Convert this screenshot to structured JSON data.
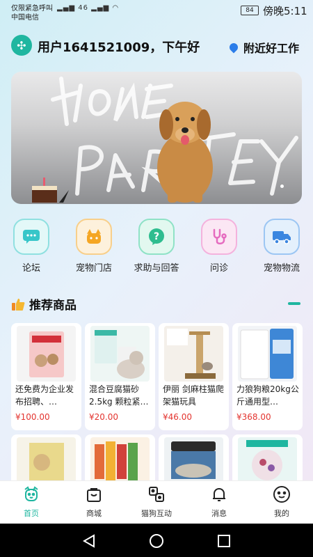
{
  "status_bar": {
    "line1": "仅限紧急呼叫",
    "line2": "中国电信",
    "network": "46",
    "battery": "84",
    "time": "傍晚5:11"
  },
  "header": {
    "greeting": "用户1641521009，下午好",
    "location_label": "附近好工作"
  },
  "categories": [
    {
      "label": "论坛",
      "icon": "chat-icon",
      "color": "#37c6c9"
    },
    {
      "label": "宠物门店",
      "icon": "cat-shop-icon",
      "color": "#f5a623"
    },
    {
      "label": "求助与回答",
      "icon": "question-icon",
      "color": "#2ebd8f"
    },
    {
      "label": "问诊",
      "icon": "stethoscope-icon",
      "color": "#e56bbf"
    },
    {
      "label": "宠物物流",
      "icon": "truck-icon",
      "color": "#3b86e0"
    }
  ],
  "section": {
    "title": "推荐商品"
  },
  "products": [
    {
      "name": "还免费为企业发布招聘、…",
      "price": "¥100.00"
    },
    {
      "name": "混合豆腐猫砂2.5kg 颗粒紧…",
      "price": "¥20.00"
    },
    {
      "name": "伊丽 剑麻柱猫爬架猫玩具",
      "price": "¥46.00"
    },
    {
      "name": "力狼狗粮20kg公斤通用型…",
      "price": "¥368.00"
    }
  ],
  "nav": [
    {
      "label": "首页",
      "icon": "dog-face-icon",
      "active": true
    },
    {
      "label": "商城",
      "icon": "shopping-bag-icon"
    },
    {
      "label": "猫狗互动",
      "icon": "interaction-icon"
    },
    {
      "label": "消息",
      "icon": "bell-icon"
    },
    {
      "label": "我的",
      "icon": "profile-icon"
    }
  ],
  "colors": {
    "accent": "#1fb6a0",
    "price": "#e3342f"
  }
}
